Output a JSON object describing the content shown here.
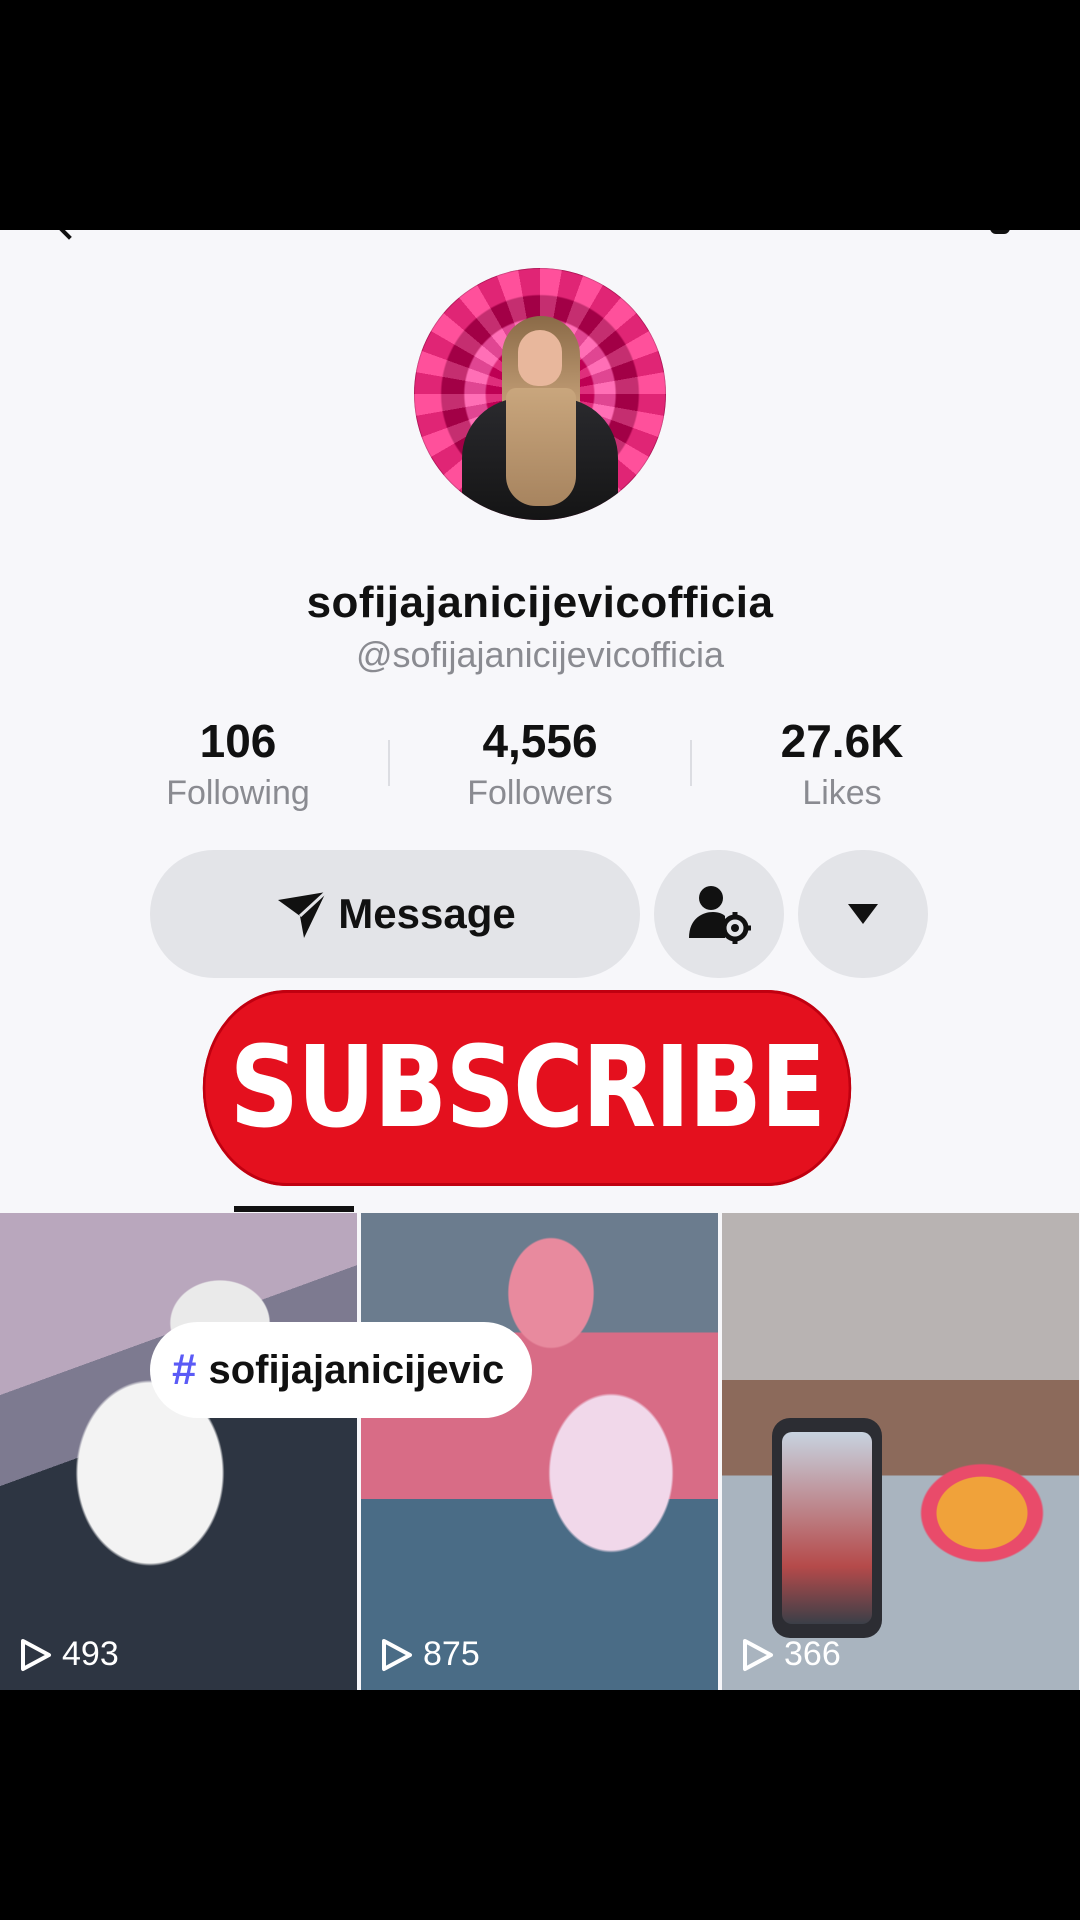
{
  "profile": {
    "display_name": "sofijajanicijevicofficia",
    "handle": "@sofijajanicijevicofficia"
  },
  "stats": [
    {
      "value": "106",
      "label": "Following"
    },
    {
      "value": "4,556",
      "label": "Followers"
    },
    {
      "value": "27.6K",
      "label": "Likes"
    }
  ],
  "actions": {
    "message_label": "Message",
    "user_settings_icon": "user-gear-icon",
    "more_icon": "caret-down-icon"
  },
  "overlay": {
    "subscribe_label": "SUBSCRIBE",
    "subscribe_color": "#e4101e",
    "hashtag_symbol": "#",
    "hashtag_text": "sofijajanicijevic"
  },
  "videos": [
    {
      "views": "493"
    },
    {
      "views": "875"
    },
    {
      "views": "366"
    }
  ]
}
